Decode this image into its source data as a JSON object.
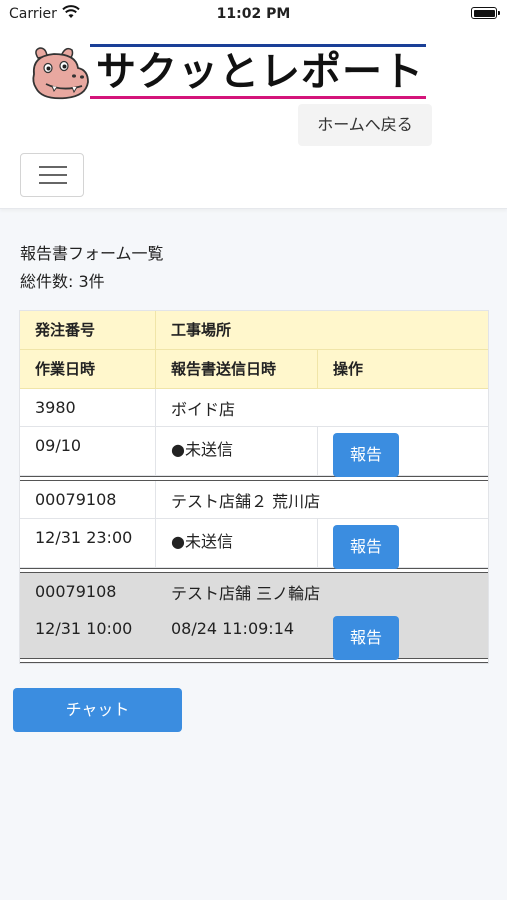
{
  "status_bar": {
    "carrier": "Carrier",
    "time": "11:02 PM"
  },
  "header": {
    "logo_text": "サクッとレポート",
    "home_button": "ホームへ戻る"
  },
  "page": {
    "title": "報告書フォーム一覧",
    "total": "総件数: 3件"
  },
  "table": {
    "headers": {
      "order_no": "発注番号",
      "site": "工事場所",
      "work_date": "作業日時",
      "sent_date": "報告書送信日時",
      "action": "操作"
    },
    "rows": [
      {
        "order_no": "3980",
        "site": "ボイド店",
        "work_date": "09/10",
        "sent": "●未送信",
        "action": "報告"
      },
      {
        "order_no": "00079108",
        "site": "テスト店舗２ 荒川店",
        "work_date": "12/31 23:00",
        "sent": "●未送信",
        "action": "報告"
      },
      {
        "order_no": "00079108",
        "site": "テスト店舗 三ノ輪店",
        "work_date": "12/31 10:00",
        "sent": "08/24 11:09:14",
        "action": "報告"
      }
    ]
  },
  "chat_button": "チャット",
  "colors": {
    "accent": "#3b8de0",
    "header_bg": "#fff7cc",
    "logo_blue": "#1a3f97",
    "logo_pink": "#d4147a"
  }
}
